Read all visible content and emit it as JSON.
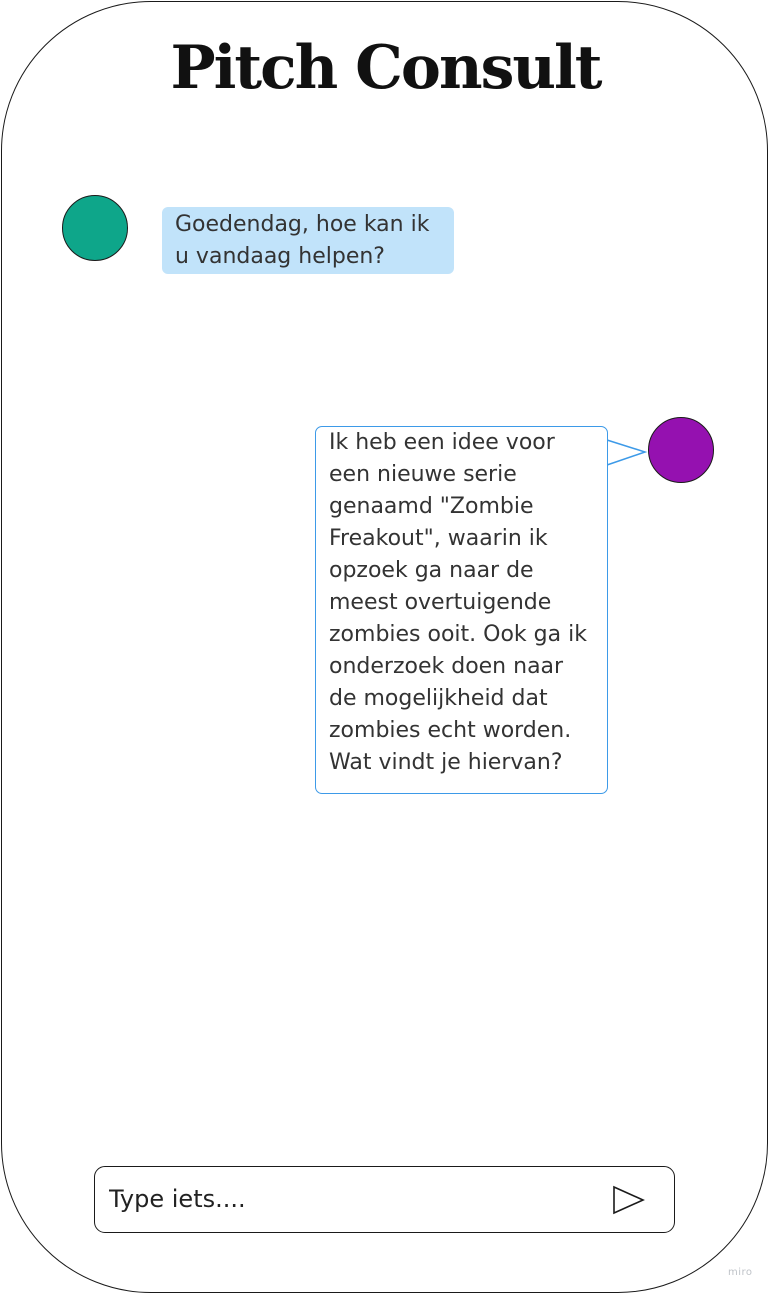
{
  "app": {
    "title": "Pitch Consult"
  },
  "messages": [
    {
      "sender": "bot",
      "text": "Goedendag, hoe kan ik u vandaag helpen?",
      "bubble_color": "#c1e3fa",
      "avatar_color": "#0ea68a"
    },
    {
      "sender": "user",
      "text": "Ik heb een idee voor een nieuwe serie genaamd \"Zombie Freakout\", waarin ik opzoek ga naar de meest overtuigende zombies ooit. Ook ga ik onderzoek doen naar de mogelijkheid dat zombies echt worden. Wat vindt je hiervan?",
      "bubble_border_color": "#3d9ae8",
      "avatar_color": "#9511b0"
    }
  ],
  "composer": {
    "value": "",
    "placeholder": "Type iets....",
    "send_icon": "send-triangle-icon"
  },
  "watermark": {
    "text": "miro"
  }
}
